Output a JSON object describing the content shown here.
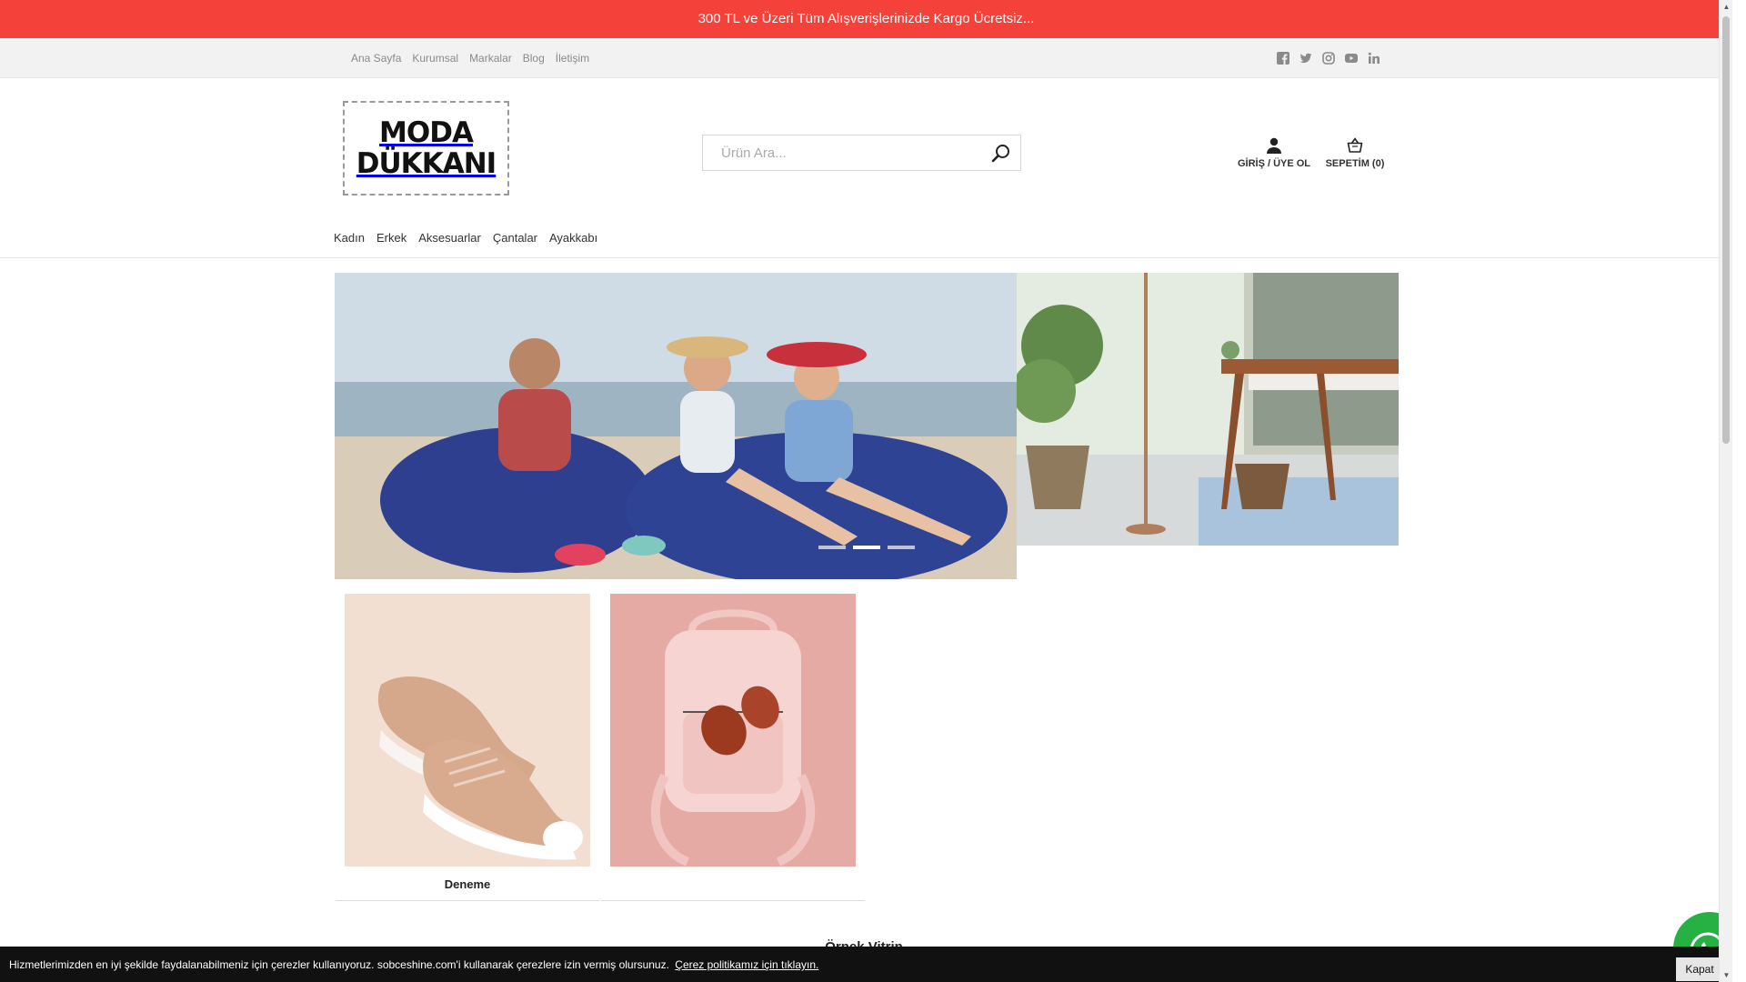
{
  "banner": {
    "text": "300 TL ve Üzeri Tüm Alışverişlerinizde Kargo Ücretsiz..."
  },
  "top_nav": [
    {
      "label": "Ana Sayfa"
    },
    {
      "label": "Kurumsal"
    },
    {
      "label": "Markalar"
    },
    {
      "label": "Blog"
    },
    {
      "label": "İletişim"
    }
  ],
  "social": [
    "facebook-icon",
    "twitter-icon",
    "instagram-icon",
    "youtube-icon",
    "linkedin-icon"
  ],
  "logo": {
    "line1": "MODA",
    "line2": "DÜKKANI"
  },
  "search": {
    "placeholder": "Ürün Ara..."
  },
  "header_actions": {
    "account_label": "GİRİŞ / ÜYE OL",
    "cart_label": "SEPETİM (0)"
  },
  "main_nav": [
    {
      "label": "Kadın"
    },
    {
      "label": "Erkek"
    },
    {
      "label": "Aksesuarlar"
    },
    {
      "label": "Çantalar"
    },
    {
      "label": "Ayakkabı"
    }
  ],
  "slider": {
    "slide_count": 3,
    "active_index": 1
  },
  "products": [
    {
      "name": "Deneme",
      "image": "sneaker"
    },
    {
      "name": "",
      "image": "backpack"
    }
  ],
  "section_title": "Örnek Vitrin",
  "cookie": {
    "text": "Hizmetlerimizden en iyi şekilde faydalanabilmeniz için çerezler kullanıyoruz. sobceshine.com'i kullanarak çerezlere izin vermiş olursunuz.",
    "link_label": "Çerez politikamız için tıklayın.",
    "close_label": "Kapat"
  },
  "colors": {
    "banner": "#f4423a",
    "topbar": "#f2f2f2",
    "cookie_bar": "#111111",
    "whatsapp": "#27b043"
  }
}
